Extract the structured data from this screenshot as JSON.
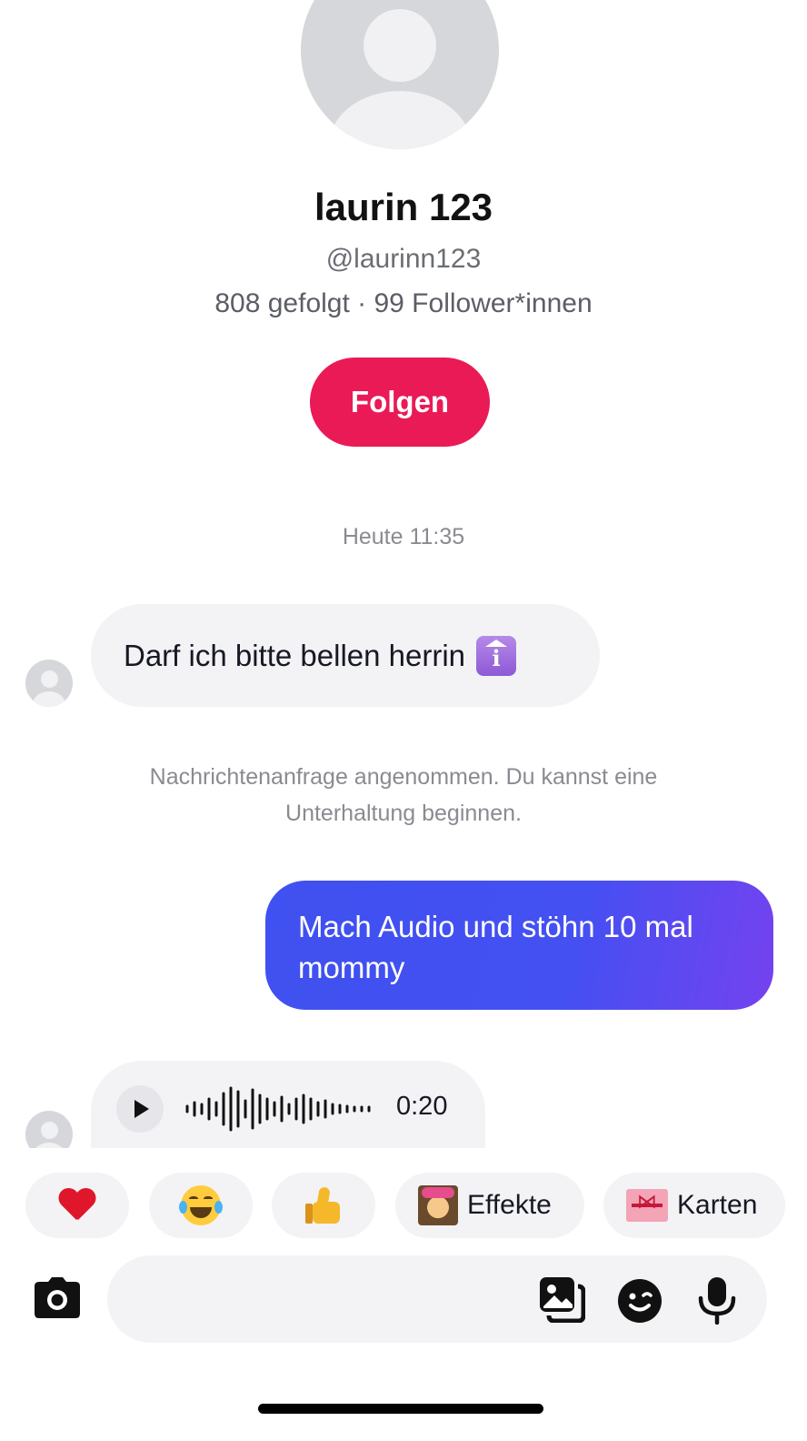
{
  "profile": {
    "display_name": "laurin 123",
    "handle": "@laurinn123",
    "stats": "808 gefolgt · 99 Follower*innen",
    "follow_label": "Folgen"
  },
  "chat": {
    "timestamp": "Heute 11:35",
    "incoming_text": "Darf ich bitte bellen herrin",
    "incoming_emoji": "info-emoji",
    "system_note": "Nachrichtenanfrage angenommen. Du kannst eine Unterhaltung beginnen.",
    "outgoing_text": "Mach Audio und stöhn 10 mal mommy",
    "voice_duration": "0:20"
  },
  "quick_reactions": {
    "heart": "heart-emoji",
    "laugh": "tears-of-joy-emoji",
    "thumb": "thumbs-up-emoji",
    "effects_label": "Effekte",
    "cards_label": "Karten"
  },
  "composer": {
    "placeholder": ""
  },
  "colors": {
    "follow_button": "#ea1a56",
    "outgoing_bubble_start": "#3f51f0",
    "outgoing_bubble_end": "#7442ef",
    "incoming_bubble": "#f3f3f5"
  }
}
